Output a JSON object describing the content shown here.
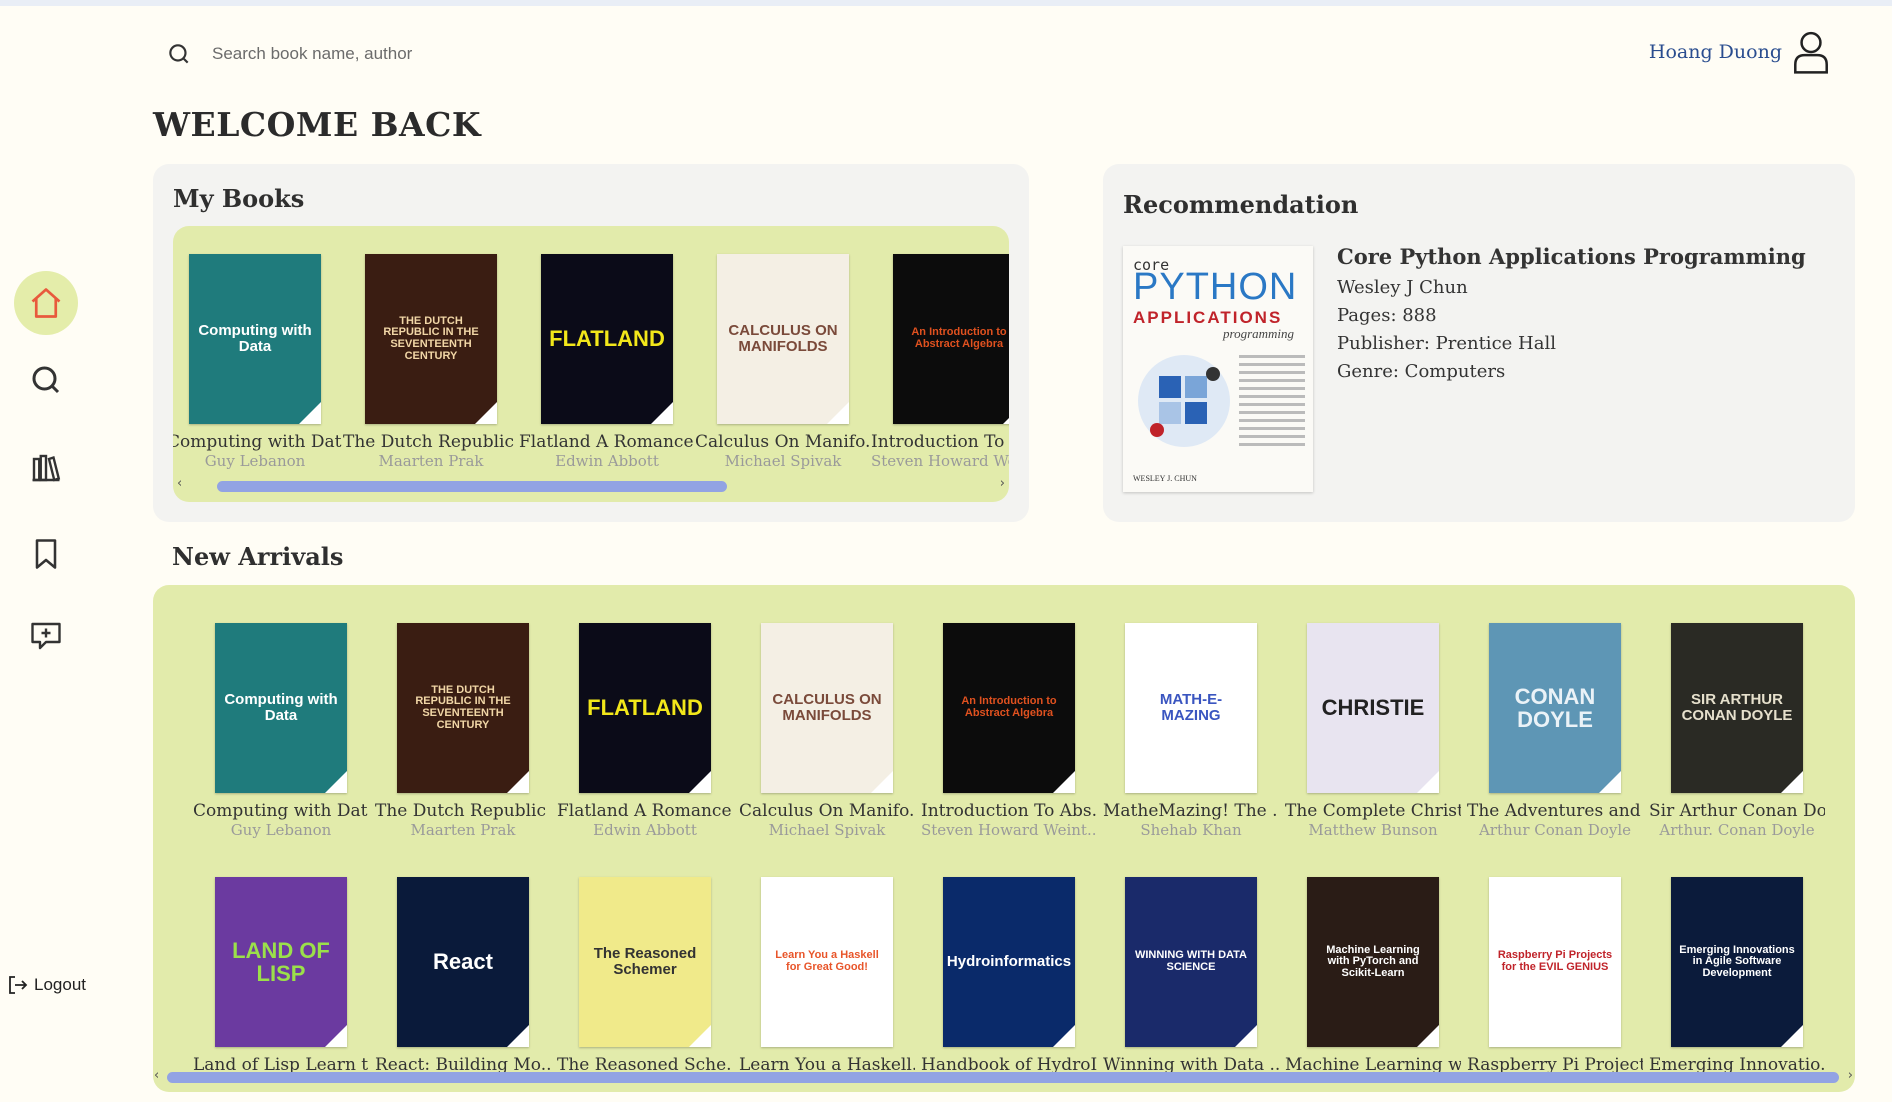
{
  "search": {
    "placeholder": "Search book name, author"
  },
  "user": {
    "name": "Hoang Duong"
  },
  "sidebar": {
    "items": [
      {
        "name": "home",
        "icon": "home-icon",
        "active": true
      },
      {
        "name": "search",
        "icon": "search-icon",
        "active": false
      },
      {
        "name": "library",
        "icon": "library-icon",
        "active": false
      },
      {
        "name": "bookmarks",
        "icon": "bookmark-icon",
        "active": false
      },
      {
        "name": "feedback",
        "icon": "message-plus-icon",
        "active": false
      }
    ],
    "logout_label": "Logout"
  },
  "welcome": "WELCOME BACK",
  "my_books": {
    "title": "My Books",
    "books": [
      {
        "title": "Computing with Dat...",
        "author": "Guy Lebanon",
        "cover": "Computing with Data",
        "bg": "#1f7b7c",
        "fg": "#ffffff"
      },
      {
        "title": "The Dutch Republic ...",
        "author": "Maarten Prak",
        "cover": "THE DUTCH REPUBLIC IN THE SEVENTEENTH CENTURY",
        "bg": "#3a1d12",
        "fg": "#f1d6a6"
      },
      {
        "title": "Flatland A Romance...",
        "author": "Edwin Abbott",
        "cover": "FLATLAND",
        "bg": "#0b0b18",
        "fg": "#f2e71a"
      },
      {
        "title": "Calculus On Manifo...",
        "author": "Michael Spivak",
        "cover": "CALCULUS ON MANIFOLDS",
        "bg": "#f4efe4",
        "fg": "#7a4a3a"
      },
      {
        "title": "Introduction To Ab...",
        "author": "Steven Howard Weintraub",
        "cover": "An Introduction to Abstract Algebra",
        "bg": "#0c0c0c",
        "fg": "#e0511f"
      }
    ]
  },
  "recommendation": {
    "title": "Recommendation",
    "book_title": "Core Python Applications Programming",
    "author": "Wesley J Chun",
    "pages": "Pages: 888",
    "publisher": "Publisher: Prentice Hall",
    "genre": "Genre: Computers",
    "cover_top": "core",
    "cover_main": "PYTHON",
    "cover_sub": "APPLICATIONS",
    "cover_small": "programming",
    "cover_author": "WESLEY J. CHUN"
  },
  "new_arrivals": {
    "title": "New Arrivals",
    "row1": [
      {
        "title": "Computing with Dat...",
        "author": "Guy Lebanon",
        "cover": "Computing with Data",
        "bg": "#1f7b7c",
        "fg": "#ffffff"
      },
      {
        "title": "The Dutch Republic ...",
        "author": "Maarten Prak",
        "cover": "THE DUTCH REPUBLIC IN THE SEVENTEENTH CENTURY",
        "bg": "#3a1d12",
        "fg": "#f1d6a6"
      },
      {
        "title": "Flatland A Romance...",
        "author": "Edwin Abbott",
        "cover": "FLATLAND",
        "bg": "#0b0b18",
        "fg": "#f2e71a"
      },
      {
        "title": "Calculus On Manifo...",
        "author": "Michael Spivak",
        "cover": "CALCULUS ON MANIFOLDS",
        "bg": "#f4efe4",
        "fg": "#7a4a3a"
      },
      {
        "title": "Introduction To Abs...",
        "author": "Steven Howard Weint...",
        "cover": "An Introduction to Abstract Algebra",
        "bg": "#0c0c0c",
        "fg": "#e0511f"
      },
      {
        "title": "MatheMazing! The ...",
        "author": "Shehab Khan",
        "cover": "MATH-E-MAZING",
        "bg": "#ffffff",
        "fg": "#3a55c0"
      },
      {
        "title": "The Complete Christ...",
        "author": "Matthew Bunson",
        "cover": "CHRISTIE",
        "bg": "#e8e4f0",
        "fg": "#222222"
      },
      {
        "title": "The Adventures and ...",
        "author": "Arthur Conan Doyle",
        "cover": "CONAN DOYLE",
        "bg": "#5e96b5",
        "fg": "#eaf2f7"
      },
      {
        "title": "Sir Arthur Conan Do...",
        "author": "Arthur. Conan Doyle",
        "cover": "SIR ARTHUR CONAN DOYLE",
        "bg": "#2a2a24",
        "fg": "#e6e0cc"
      }
    ],
    "row2": [
      {
        "title": "Land of Lisp Learn t...",
        "author": "",
        "cover": "LAND OF LISP",
        "bg": "#6b3aa0",
        "fg": "#9be04a"
      },
      {
        "title": "React: Building Mo...",
        "author": "",
        "cover": "React",
        "bg": "#0a1a3a",
        "fg": "#ffffff"
      },
      {
        "title": "The Reasoned Sche...",
        "author": "",
        "cover": "The Reasoned Schemer",
        "bg": "#f0ea8a",
        "fg": "#333333"
      },
      {
        "title": "Learn You a Haskell...",
        "author": "",
        "cover": "Learn You a Haskell for Great Good!",
        "bg": "#ffffff",
        "fg": "#e8552a"
      },
      {
        "title": "Handbook of HydroI...",
        "author": "",
        "cover": "Hydroinformatics",
        "bg": "#0a2a6a",
        "fg": "#ffffff"
      },
      {
        "title": "Winning with Data ...",
        "author": "",
        "cover": "WINNING WITH DATA SCIENCE",
        "bg": "#1a2a6a",
        "fg": "#ffffff"
      },
      {
        "title": "Machine Learning w...",
        "author": "",
        "cover": "Machine Learning with PyTorch and Scikit-Learn",
        "bg": "#2a1c16",
        "fg": "#ffffff"
      },
      {
        "title": "Raspberry Pi Project...",
        "author": "",
        "cover": "Raspberry Pi Projects for the EVIL GENIUS",
        "bg": "#ffffff",
        "fg": "#c0232a"
      },
      {
        "title": "Emerging Innovatio...",
        "author": "",
        "cover": "Emerging Innovations in Agile Software Development",
        "bg": "#0b1b3b",
        "fg": "#ffffff"
      }
    ]
  },
  "colors": {
    "accent_green": "#e2ebab",
    "scrollbar": "#92a3e3",
    "link_blue": "#2a4d8f"
  }
}
